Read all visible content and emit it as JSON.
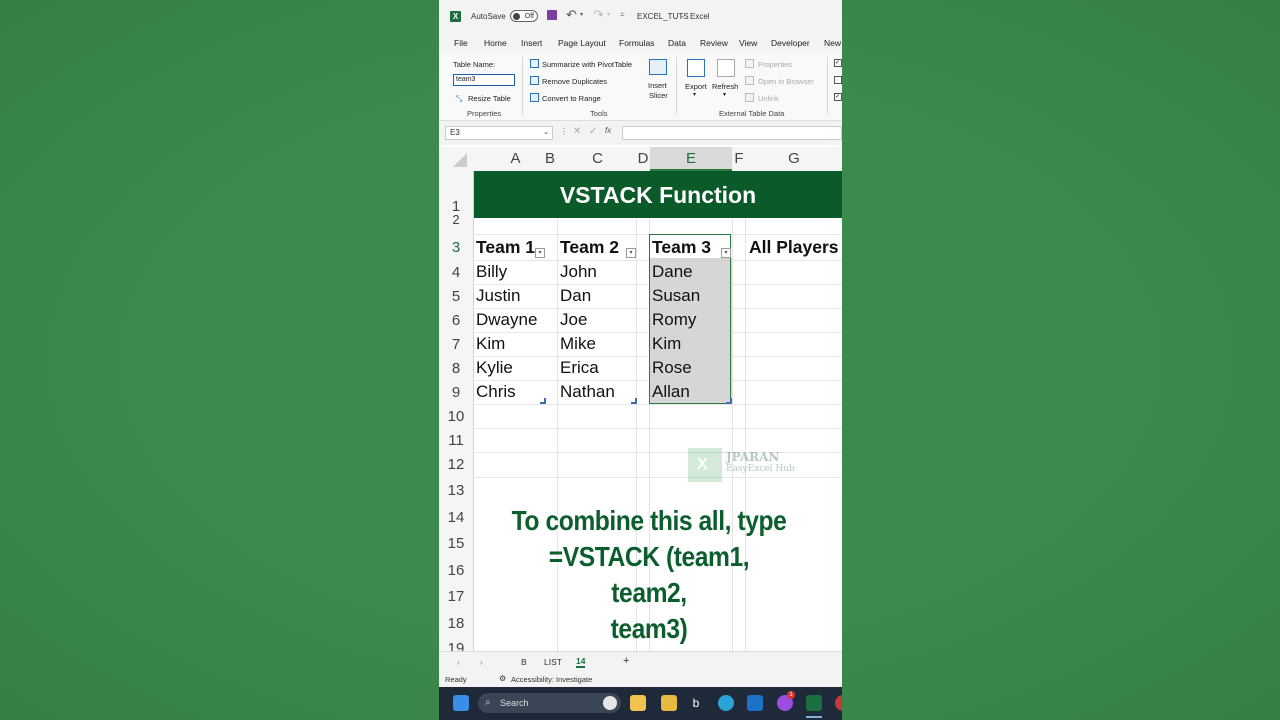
{
  "titlebar": {
    "autosave_label": "AutoSave",
    "autosave_state": "Off",
    "filename": "EXCEL_TUTS",
    "separator": "-",
    "app_name": "Excel"
  },
  "menu": [
    "File",
    "Home",
    "Insert",
    "Page Layout",
    "Formulas",
    "Data",
    "Review",
    "View",
    "Developer",
    "New"
  ],
  "ribbon": {
    "properties": {
      "table_name_label": "Table Name:",
      "table_name_value": "team3",
      "resize_table": "Resize Table",
      "group_label": "Properties"
    },
    "tools": {
      "summarize": "Summarize with PivotTable",
      "remove_duplicates": "Remove Duplicates",
      "convert_to_range": "Convert to Range",
      "insert_slicer_1": "Insert",
      "insert_slicer_2": "Slicer",
      "group_label": "Tools"
    },
    "external": {
      "export": "Export",
      "refresh": "Refresh",
      "properties": "Properties",
      "open_in_browser": "Open in Browser",
      "unlink": "Unlink",
      "group_label": "External Table Data"
    }
  },
  "formula_bar": {
    "name_box": "E3",
    "fx": "fx",
    "formula": ""
  },
  "columns": [
    "A",
    "B",
    "C",
    "D",
    "E",
    "F",
    "G"
  ],
  "rows": [
    "1",
    "2",
    "3",
    "4",
    "5",
    "6",
    "7",
    "8",
    "9",
    "10",
    "11",
    "12",
    "13",
    "14",
    "15",
    "16",
    "17",
    "18",
    "19"
  ],
  "sheet": {
    "title": "VSTACK Function",
    "headers": {
      "team1": "Team 1",
      "team2": "Team 2",
      "team3": "Team 3",
      "all": "All Players"
    },
    "team1": [
      "Billy",
      "Justin",
      "Dwayne",
      "Kim",
      "Kylie",
      "Chris"
    ],
    "team2": [
      "John",
      "Dan",
      "Joe",
      "Mike",
      "Erica",
      "Nathan"
    ],
    "team3": [
      "Dane",
      "Susan",
      "Romy",
      "Kim",
      "Rose",
      "Allan"
    ]
  },
  "caption": {
    "line1": "To combine this all, type",
    "line2": "=VSTACK (team1, team2,",
    "line3": "team3)"
  },
  "watermark": {
    "line1": "JPARAN",
    "line2": "EasyExcel Hub",
    "logo_letter": "X"
  },
  "sheet_tabs": {
    "tabs": [
      "B",
      "LIST",
      "14"
    ],
    "active": "14",
    "add": "+",
    "prev": "‹",
    "next": "›"
  },
  "status_bar": {
    "ready": "Ready",
    "accessibility": "Accessibility: Investigate"
  },
  "taskbar": {
    "search_placeholder": "Search",
    "notification_count": "1"
  },
  "colors": {
    "banner": "#0b5a2a",
    "caption": "#0d5e2e",
    "selection_border": "#2c7a3d",
    "background": "#3f8f4f"
  }
}
